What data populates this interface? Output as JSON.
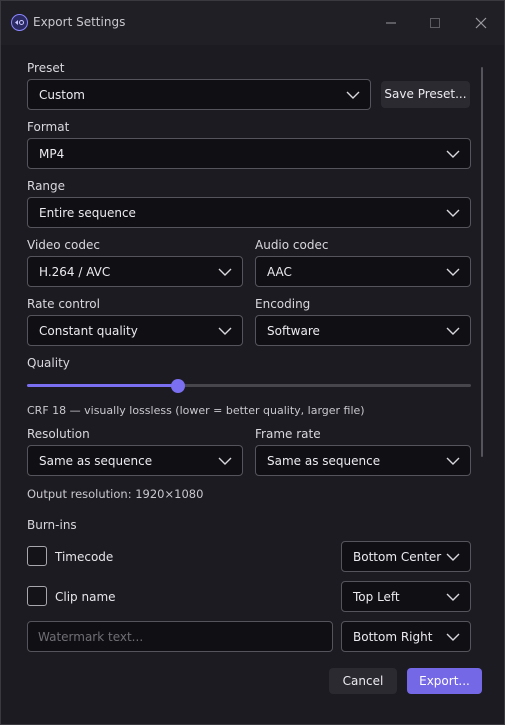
{
  "window": {
    "title": "Export Settings"
  },
  "preset": {
    "label": "Preset",
    "value": "Custom",
    "save_button": "Save Preset..."
  },
  "format": {
    "label": "Format",
    "value": "MP4"
  },
  "range": {
    "label": "Range",
    "value": "Entire sequence"
  },
  "video_codec": {
    "label": "Video codec",
    "value": "H.264 / AVC"
  },
  "audio_codec": {
    "label": "Audio codec",
    "value": "AAC"
  },
  "rate_control": {
    "label": "Rate control",
    "value": "Constant quality"
  },
  "encoding": {
    "label": "Encoding",
    "value": "Software"
  },
  "quality": {
    "label": "Quality",
    "value_fraction": 0.34,
    "info": "CRF 18 — visually lossless  (lower = better quality, larger file)"
  },
  "resolution": {
    "label": "Resolution",
    "value": "Same as sequence"
  },
  "frame_rate": {
    "label": "Frame rate",
    "value": "Same as sequence"
  },
  "output_resolution": "Output resolution: 1920×1080",
  "burnins": {
    "label": "Burn-ins",
    "timecode": {
      "label": "Timecode",
      "checked": false,
      "position": "Bottom Center"
    },
    "clip_name": {
      "label": "Clip name",
      "checked": false,
      "position": "Top Left"
    },
    "watermark": {
      "placeholder": "Watermark text...",
      "value": "",
      "position": "Bottom Right"
    }
  },
  "actions": {
    "cancel": "Cancel",
    "export": "Export..."
  },
  "colors": {
    "accent": "#7468e6",
    "background": "#1c1b21",
    "field": "#101014",
    "border": "#55545c"
  }
}
